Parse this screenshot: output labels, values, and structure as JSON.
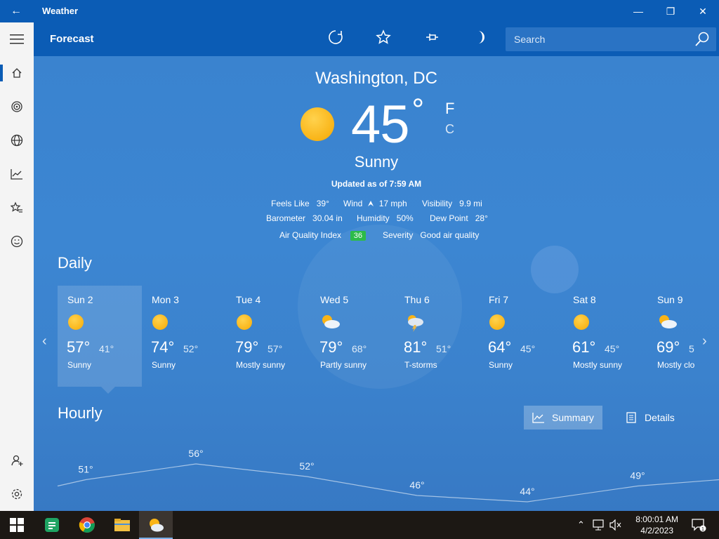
{
  "window": {
    "title": "Weather",
    "back_glyph": "←",
    "minimize_glyph": "—",
    "restore_glyph": "❐",
    "close_glyph": "✕"
  },
  "header": {
    "title": "Forecast",
    "search_placeholder": "Search"
  },
  "current": {
    "city": "Washington, DC",
    "temp": "45",
    "deg": "°",
    "unit_f": "F",
    "unit_c": "C",
    "condition": "Sunny",
    "updated": "Updated as of 7:59 AM",
    "feels_like_label": "Feels Like",
    "feels_like": "39°",
    "wind_label": "Wind",
    "wind": "17 mph",
    "visibility_label": "Visibility",
    "visibility": "9.9 mi",
    "barometer_label": "Barometer",
    "barometer": "30.04 in",
    "humidity_label": "Humidity",
    "humidity": "50%",
    "dew_point_label": "Dew Point",
    "dew_point": "28°",
    "aqi_label": "Air Quality Index",
    "aqi": "36",
    "severity_label": "Severity",
    "severity": "Good air quality"
  },
  "daily": {
    "title": "Daily",
    "prev_glyph": "‹",
    "next_glyph": "›",
    "days": [
      {
        "name": "Sun 2",
        "hi": "57°",
        "lo": "41°",
        "cond": "Sunny",
        "icon": "sun-icon"
      },
      {
        "name": "Mon 3",
        "hi": "74°",
        "lo": "52°",
        "cond": "Sunny",
        "icon": "sun-icon"
      },
      {
        "name": "Tue 4",
        "hi": "79°",
        "lo": "57°",
        "cond": "Mostly sunny",
        "icon": "sun-icon"
      },
      {
        "name": "Wed 5",
        "hi": "79°",
        "lo": "68°",
        "cond": "Partly sunny",
        "icon": "partly-sunny-icon"
      },
      {
        "name": "Thu 6",
        "hi": "81°",
        "lo": "51°",
        "cond": "T-storms",
        "icon": "thunderstorm-icon"
      },
      {
        "name": "Fri 7",
        "hi": "64°",
        "lo": "45°",
        "cond": "Sunny",
        "icon": "sun-icon"
      },
      {
        "name": "Sat 8",
        "hi": "61°",
        "lo": "45°",
        "cond": "Mostly sunny",
        "icon": "sun-icon"
      },
      {
        "name": "Sun 9",
        "hi": "69°",
        "lo": "5",
        "cond": "Mostly clo",
        "icon": "partly-sunny-icon"
      }
    ]
  },
  "hourly": {
    "title": "Hourly",
    "summary_label": "Summary",
    "details_label": "Details",
    "points": [
      {
        "label": "51°",
        "value": 51
      },
      {
        "label": "56°",
        "value": 56
      },
      {
        "label": "52°",
        "value": 52
      },
      {
        "label": "46°",
        "value": 46
      },
      {
        "label": "44°",
        "value": 44
      },
      {
        "label": "49°",
        "value": 49
      }
    ]
  },
  "taskbar": {
    "time": "8:00:01 AM",
    "date": "4/2/2023",
    "notifications": "1"
  },
  "colors": {
    "accent": "#0b5cb5",
    "sky": "#3a83cf",
    "aqi_good": "#2dbb4a"
  }
}
